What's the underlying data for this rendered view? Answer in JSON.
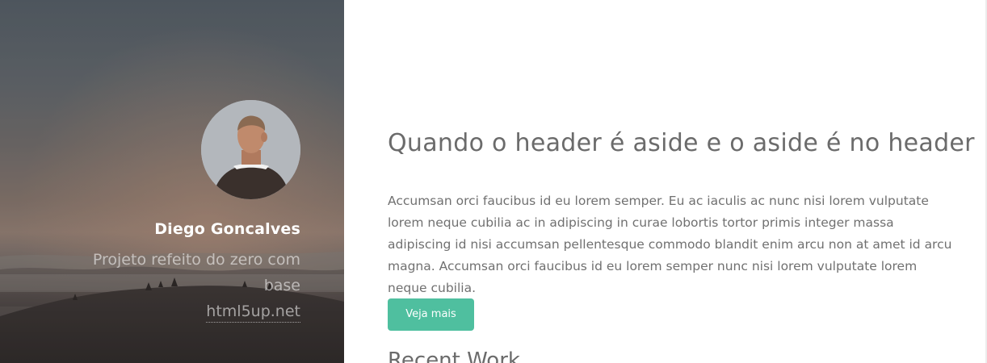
{
  "profile": {
    "name": "Diego Goncalves",
    "tagline": "Projeto refeito do zero com base",
    "link_text": "html5up.net"
  },
  "main": {
    "headline": "Quando o header é aside e o aside é no header",
    "body": "Accumsan orci faucibus id eu lorem semper. Eu ac iaculis ac nunc nisi lorem vulputate lorem neque cubilia ac in adipiscing in curae lobortis tortor primis integer massa adipiscing id nisi accumsan pellentesque commodo blandit enim arcu non at amet id arcu magna. Accumsan orci faucibus id eu lorem semper nunc nisi lorem vulputate lorem neque cubilia.",
    "button_label": "Veja mais",
    "section_heading": "Recent Work"
  },
  "colors": {
    "accent": "#4fbf9f",
    "heading_text": "#6b6b6b",
    "body_text": "#707070"
  }
}
